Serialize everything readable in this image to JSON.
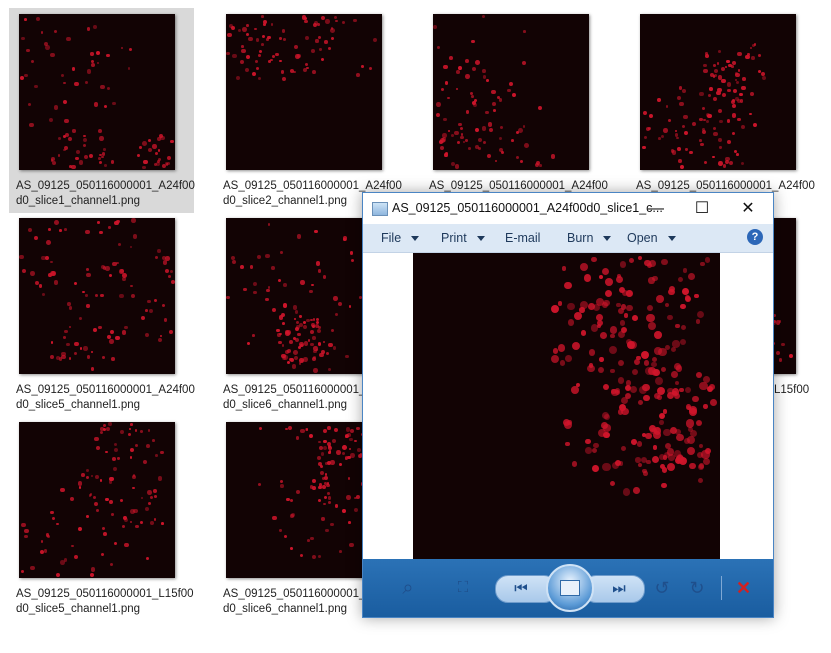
{
  "files": [
    {
      "name_line1": "AS_09125_050116000001_A24f00",
      "name_line2": "d0_slice1_channel1.png",
      "selected": true
    },
    {
      "name_line1": "AS_09125_050116000001_A24f00",
      "name_line2": "d0_slice2_channel1.png",
      "selected": false
    },
    {
      "name_line1": "AS_09125_050116000001_A24f00",
      "name_line2": "",
      "selected": false
    },
    {
      "name_line1": "AS_09125_050116000001_A24f00",
      "name_line2": "",
      "selected": false
    },
    {
      "name_line1": "AS_09125_050116000001_A24f00",
      "name_line2": "d0_slice5_channel1.png",
      "selected": false
    },
    {
      "name_line1": "AS_09125_050116000001_A",
      "name_line2": "d0_slice6_channel1.png",
      "selected": false
    },
    {
      "name_line1": "L15f00",
      "name_line2": "",
      "selected": false
    },
    {
      "name_line1": "AS_09125_050116000001_L15f00",
      "name_line2": "d0_slice5_channel1.png",
      "selected": false
    },
    {
      "name_line1": "AS_09125_050116000001_L",
      "name_line2": "d0_slice6_channel1.png",
      "selected": false
    }
  ],
  "viewer": {
    "title": "AS_09125_050116000001_A24f00d0_slice1_c...",
    "minimize": "—",
    "maximize": "☐",
    "close": "✕",
    "menu": {
      "file": "File",
      "print": "Print",
      "email": "E-mail",
      "burn": "Burn",
      "open": "Open"
    },
    "help": "?",
    "toolbar": {
      "zoom_icon": "⌕",
      "fit_icon": "⛶",
      "prev_icon": "⏮",
      "next_icon": "⏭",
      "rotate_ccw_icon": "↺",
      "rotate_cw_icon": "↻",
      "delete_icon": "✕"
    }
  },
  "colors": {
    "cell": "#d0152b",
    "image_bg": "#120304",
    "accent": "#1a5da0"
  }
}
